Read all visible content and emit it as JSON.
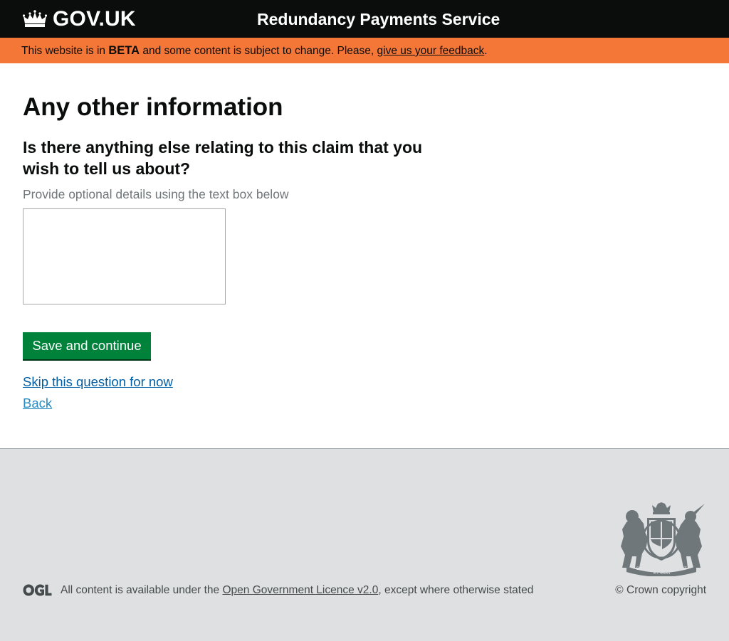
{
  "header": {
    "logo_text": "GOV.UK",
    "service_name": "Redundancy Payments Service"
  },
  "beta_banner": {
    "prefix": "This website is in ",
    "tag": "BETA",
    "middle": " and some content is subject to change. Please, ",
    "link_text": "give us your feedback",
    "suffix": "."
  },
  "main": {
    "title": "Any other information",
    "question": "Is there anything else relating to this claim that you wish to tell us about?",
    "hint": "Provide optional details using the text box below",
    "textarea_value": "",
    "save_button": "Save and continue",
    "skip_link": "Skip this question for now",
    "back_link": "Back"
  },
  "footer": {
    "licence_prefix": "All content is available under the ",
    "licence_link": "Open Government Licence v2.0",
    "licence_suffix": ", except where otherwise stated",
    "copyright": "© Crown copyright",
    "crest_motto_1": "DIEU",
    "crest_motto_2": "ET MON",
    "crest_motto_3": "DROIT"
  },
  "colors": {
    "header_bg": "#0b0c0c",
    "beta_bg": "#f47738",
    "button_green": "#00823b",
    "link_blue": "#005ea5",
    "footer_bg": "#dee0e2"
  },
  "icons": {
    "header_logo": "crown-icon",
    "footer_crest": "royal-coat-of-arms-icon",
    "footer_licence": "ogl-logo-icon"
  }
}
